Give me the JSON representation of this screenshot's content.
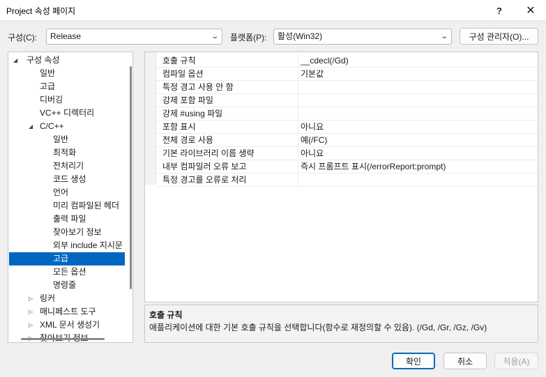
{
  "window": {
    "title": "Project 속성 페이지",
    "help_label": "?",
    "close_label": "✕"
  },
  "toolbar": {
    "config_label": "구성(C):",
    "config_value": "Release",
    "platform_label": "플랫폼(P):",
    "platform_value": "활성(Win32)",
    "config_manager_label": "구성 관리자(O)..."
  },
  "tree": {
    "items": [
      {
        "label": "구성 속성",
        "expanded": true
      },
      {
        "label": "일반"
      },
      {
        "label": "고급"
      },
      {
        "label": "디버깅"
      },
      {
        "label": "VC++ 디렉터리"
      },
      {
        "label": "C/C++",
        "expanded": true
      },
      {
        "label": "일반"
      },
      {
        "label": "최적화"
      },
      {
        "label": "전처리기"
      },
      {
        "label": "코드 생성"
      },
      {
        "label": "언어"
      },
      {
        "label": "미리 컴파일된 헤더"
      },
      {
        "label": "출력 파일"
      },
      {
        "label": "찾아보기 정보"
      },
      {
        "label": "외부 include 지시문"
      },
      {
        "label": "고급",
        "selected": true
      },
      {
        "label": "모든 옵션"
      },
      {
        "label": "명령줄"
      },
      {
        "label": "링커",
        "expanded": false
      },
      {
        "label": "매니페스트 도구",
        "expanded": false
      },
      {
        "label": "XML 문서 생성기",
        "expanded": false
      },
      {
        "label": "찾아보기 정보",
        "expanded": false
      }
    ]
  },
  "properties": [
    {
      "name": "호출 규칙",
      "value": "__cdecl(/Gd)"
    },
    {
      "name": "컴파일 옵션",
      "value": "기본값"
    },
    {
      "name": "특정 경고 사용 안 함",
      "value": ""
    },
    {
      "name": "강제 포함 파일",
      "value": ""
    },
    {
      "name": "강제 #using 파일",
      "value": ""
    },
    {
      "name": "포함 표시",
      "value": "아니요"
    },
    {
      "name": "전체 경로 사용",
      "value": "예(/FC)"
    },
    {
      "name": "기본 라이브러리 이름 생략",
      "value": "아니요"
    },
    {
      "name": "내부 컴파일러 오류 보고",
      "value": "즉시 프롬프트 표시(/errorReport:prompt)"
    },
    {
      "name": "특정 경고를 오류로 처리",
      "value": ""
    }
  ],
  "description": {
    "title": "호출 규칙",
    "text": "애플리케이션에 대한 기본 호출 규칙을 선택합니다(함수로 재정의할 수 있음).     (/Gd, /Gr, /Gz, /Gv)"
  },
  "buttons": {
    "ok": "확인",
    "cancel": "취소",
    "apply": "적용(A)"
  },
  "colors": {
    "accent": "#0067c0"
  }
}
